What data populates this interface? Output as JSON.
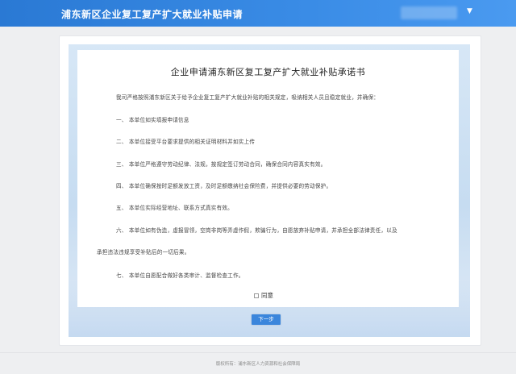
{
  "header": {
    "title": "浦东新区企业复工复产扩大就业补贴申请",
    "user_caret_icon": "caret-down-icon"
  },
  "document": {
    "title": "企业申请浦东新区复工复产扩大就业补贴承诺书",
    "intro": "我司严格按照浦东新区关于给予企业复工复产扩大就业补贴的相关规定，吸纳相关人员且稳定就业，并确保：",
    "items": [
      "一、  本单位如实填报申请信息",
      "二、  本单位接受平台要求提供的相关证明材料并如实上传",
      "三、  本单位严格遵守劳动纪律、法规，按规定签订劳动合同，确保合同内容真实有效。",
      "四、  本单位确保按时足额发放工资，及时足额缴纳社会保险费，并提供必要的劳动保护。",
      "五、  本单位实际经营地址、联系方式真实有效。",
      "六、  本单位如有伪造，虚报冒领，空岗非岗等弄虚作假，欺骗行为，自愿放弃补贴申请，并承担全部法律责任，以及",
      "承担违法违规享受补贴后的一切后果。",
      "七、  本单位自愿配合做好各类审计、监督检查工作。"
    ]
  },
  "form": {
    "agree_label": "同意",
    "agree_checked": false,
    "next_button": "下一步"
  },
  "footer": {
    "copyright": "版权所有：浦东新区人力资源和社会保障局"
  }
}
